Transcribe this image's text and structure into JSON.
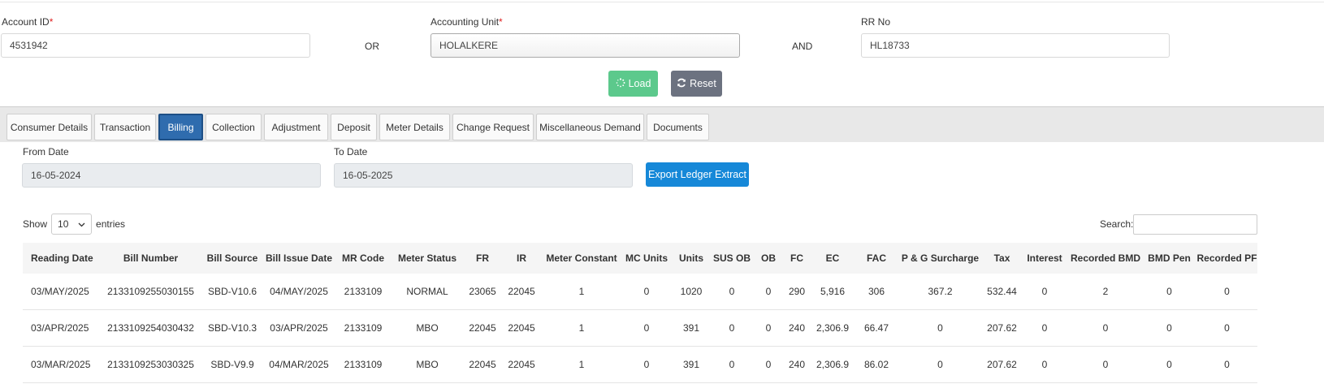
{
  "search_form": {
    "account_id": {
      "label": "Account ID",
      "required_mark": "*",
      "value": "4531942"
    },
    "or_label": "OR",
    "accounting_unit": {
      "label": "Accounting Unit",
      "required_mark": "*",
      "value": "HOLALKERE"
    },
    "and_label": "AND",
    "rr_no": {
      "label": "RR No",
      "value": "HL18733"
    },
    "load_label": "Load",
    "reset_label": "Reset"
  },
  "tabs": [
    {
      "label": "Consumer Details"
    },
    {
      "label": "Transaction"
    },
    {
      "label": "Billing",
      "active": true
    },
    {
      "label": "Collection"
    },
    {
      "label": "Adjustment"
    },
    {
      "label": "Deposit"
    },
    {
      "label": "Meter Details"
    },
    {
      "label": "Change Request"
    },
    {
      "label": "Miscellaneous Demand"
    },
    {
      "label": "Documents"
    }
  ],
  "billing": {
    "from_date": {
      "label": "From Date",
      "value": "16-05-2024"
    },
    "to_date": {
      "label": "To Date",
      "value": "16-05-2025"
    },
    "export_label": "Export Ledger Extract",
    "show_label": "Show",
    "page_size": "10",
    "entries_label": "entries",
    "search_label": "Search:",
    "search_value": ""
  },
  "table": {
    "columns": [
      "Reading Date",
      "Bill Number",
      "Bill Source",
      "Bill Issue Date",
      "MR Code",
      "Meter Status",
      "FR",
      "IR",
      "Meter Constant",
      "MC Units",
      "Units",
      "SUS OB",
      "OB",
      "FC",
      "EC",
      "FAC",
      "P & G Surcharge",
      "Tax",
      "Interest",
      "Recorded BMD",
      "BMD Pen",
      "Recorded PF"
    ],
    "rows": [
      [
        "03/MAY/2025",
        "2133109255030155",
        "SBD-V10.6",
        "04/MAY/2025",
        "2133109",
        "NORMAL",
        "23065",
        "22045",
        "1",
        "0",
        "1020",
        "0",
        "0",
        "290",
        "5,916",
        "306",
        "367.2",
        "532.44",
        "0",
        "2",
        "0",
        "0"
      ],
      [
        "03/APR/2025",
        "2133109254030432",
        "SBD-V10.3",
        "03/APR/2025",
        "2133109",
        "MBO",
        "22045",
        "22045",
        "1",
        "0",
        "391",
        "0",
        "0",
        "240",
        "2,306.9",
        "66.47",
        "0",
        "207.62",
        "0",
        "0",
        "0",
        "0"
      ],
      [
        "03/MAR/2025",
        "2133109253030325",
        "SBD-V9.9",
        "04/MAR/2025",
        "2133109",
        "MBO",
        "22045",
        "22045",
        "1",
        "0",
        "391",
        "0",
        "0",
        "240",
        "2,306.9",
        "86.02",
        "0",
        "207.62",
        "0",
        "0",
        "0",
        "0"
      ]
    ]
  }
}
